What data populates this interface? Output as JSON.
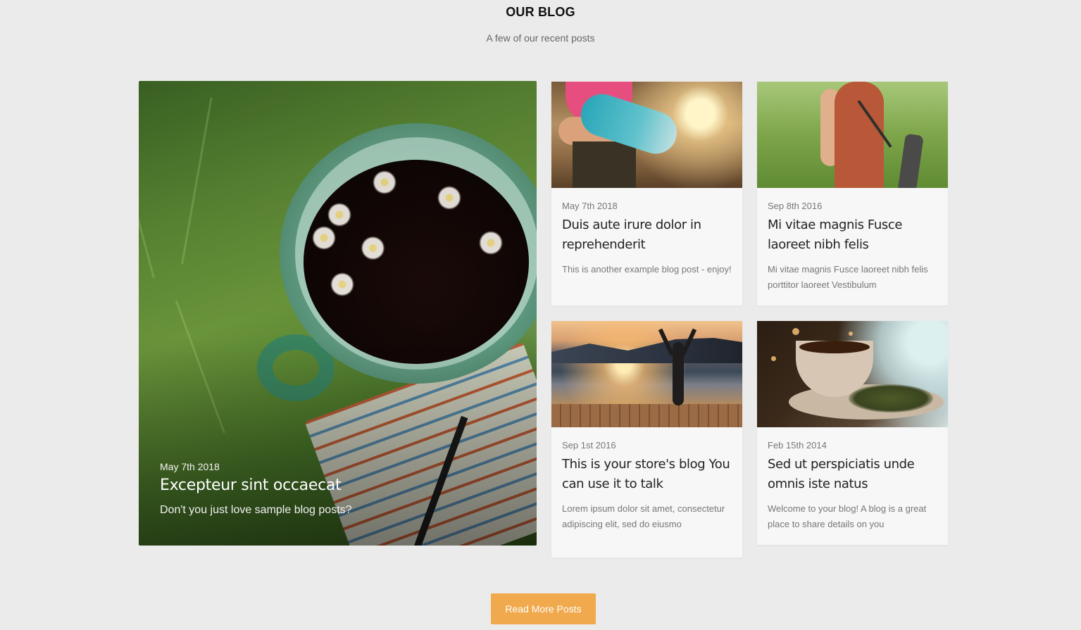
{
  "header": {
    "title": "OUR BLOG",
    "subtitle": "A few of our recent posts"
  },
  "featured_post": {
    "date": "May 7th 2018",
    "title": "Excepteur sint occaecat",
    "excerpt": "Don't you just love sample blog posts?"
  },
  "posts": [
    {
      "date": "May 7th 2018",
      "title": "Duis aute irure dolor in reprehenderit",
      "excerpt": "This is another example blog post - enjoy!"
    },
    {
      "date": "Sep 8th 2016",
      "title": "Mi vitae magnis Fusce laoreet nibh felis",
      "excerpt": "Mi vitae magnis Fusce laoreet nibh felis porttitor laoreet Vestibulum"
    },
    {
      "date": "Sep 1st 2016",
      "title": "This is your store's blog You can use it to talk",
      "excerpt": "Lorem ipsum dolor sit amet, consectetur adipiscing elit, sed do eiusmo"
    },
    {
      "date": "Feb 15th 2014",
      "title": "Sed ut perspiciatis unde omnis iste natus",
      "excerpt": "Welcome to your blog! A blog is a great place to share details on you"
    }
  ],
  "read_more_label": "Read More Posts",
  "colors": {
    "page_background": "#ebebeb",
    "card_background": "#f7f7f7",
    "button": "#f0a94c"
  }
}
